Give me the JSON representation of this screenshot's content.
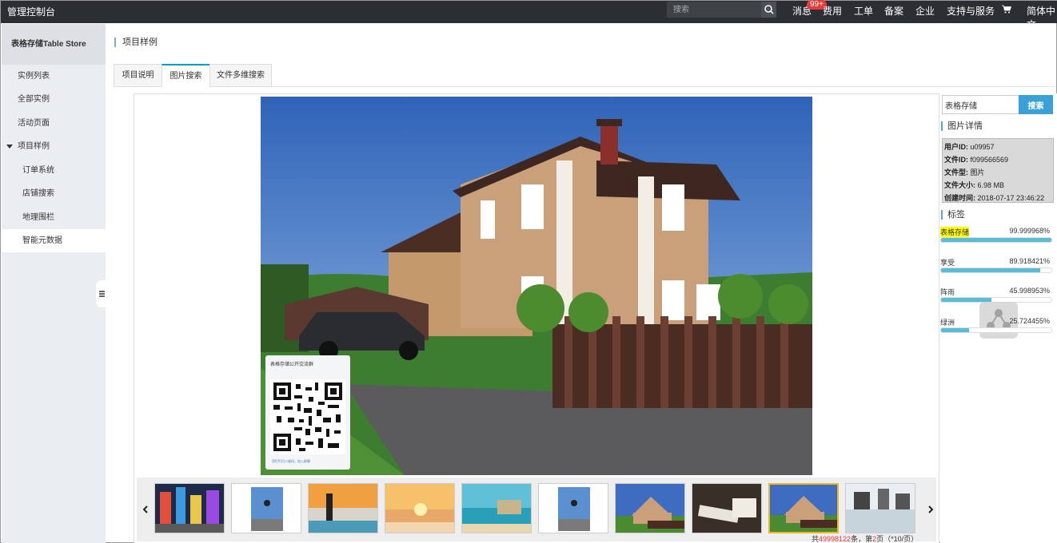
{
  "topbar": {
    "title": "管理控制台",
    "search_placeholder": "搜索",
    "nav": [
      "消息",
      "费用",
      "工单",
      "备案",
      "企业",
      "支持与服务",
      "简体中文"
    ],
    "badge": "99+"
  },
  "sidebar": {
    "product": "表格存储Table Store",
    "items": [
      {
        "label": "实例列表"
      },
      {
        "label": "全部实例"
      },
      {
        "label": "活动页面"
      },
      {
        "label": "项目样例"
      },
      {
        "label": "订单系统"
      },
      {
        "label": "店铺搜索"
      },
      {
        "label": "地理围栏"
      },
      {
        "label": "智能元数据"
      }
    ]
  },
  "main": {
    "title": "项目样例",
    "tabs": [
      {
        "label": "项目说明"
      },
      {
        "label": "图片搜索"
      },
      {
        "label": "文件多维搜索"
      }
    ]
  },
  "qr": {
    "title": "表格存储公开交流群",
    "footer": "用钉钉扫二维码，加入群聊"
  },
  "pager": {
    "prefix": "共",
    "total": "49998122",
    "mid": "条，第",
    "page": "2",
    "suffix": "页（*10/页）"
  },
  "right": {
    "search_value": "表格存储",
    "search_button": "搜索",
    "details_title": "图片详情",
    "details": [
      {
        "key": "用户ID:",
        "value": "u09957"
      },
      {
        "key": "文件ID:",
        "value": "f099566569"
      },
      {
        "key": "文件型:",
        "value": "图片"
      },
      {
        "key": "文件大小:",
        "value": "6.98 MB"
      },
      {
        "key": "创建时间:",
        "value": "2018-07-17 23:46:22"
      }
    ],
    "tags_title": "标签",
    "tags": [
      {
        "name": "表格存储",
        "percent": "99.999968%",
        "fill": 0.99999968
      },
      {
        "name": "享受",
        "percent": "89.918421%",
        "fill": 0.89918421
      },
      {
        "name": "阵雨",
        "percent": "45.998953%",
        "fill": 0.45998953
      },
      {
        "name": "绿洲",
        "percent": "25.724455%",
        "fill": 0.25724455
      }
    ]
  },
  "colors": {
    "topbar": "#2b2f33",
    "accent": "#00a2ca",
    "search_button": "#3aa0d8",
    "bar_fill": "#5bbcd8",
    "badge": "#e63b3b",
    "highlight": "#ffff00"
  }
}
